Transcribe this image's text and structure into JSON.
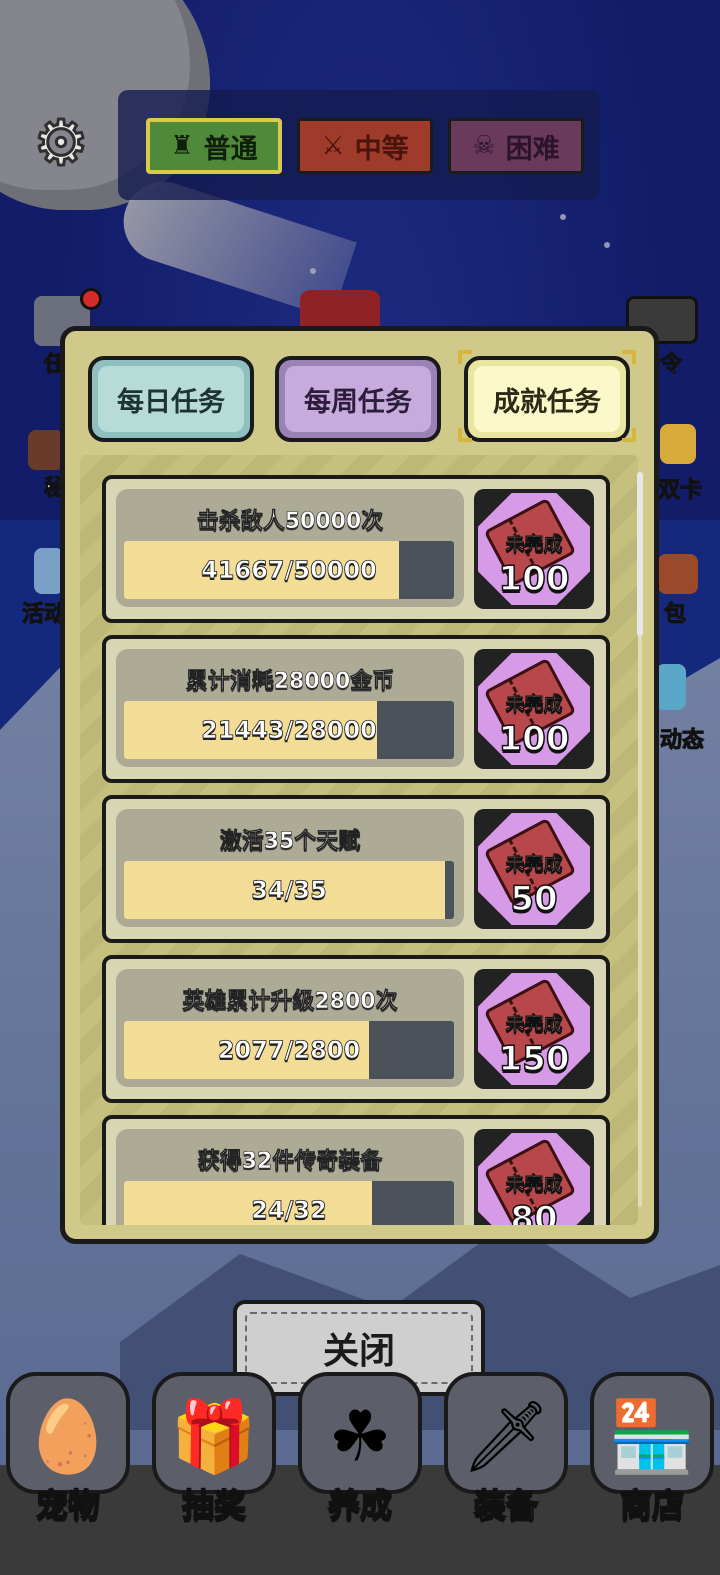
{
  "difficulty": {
    "normal_label": "普通",
    "medium_label": "中等",
    "hard_label": "困难"
  },
  "side_icons": {
    "left": [
      "任",
      "秘",
      "活动"
    ],
    "right": [
      "令",
      "双卡",
      "包",
      "动态"
    ]
  },
  "tabs": {
    "daily": "每日任务",
    "weekly": "每周任务",
    "achievement": "成就任务",
    "selected": "achievement"
  },
  "tasks": [
    {
      "title": "击杀敌人50000次",
      "progress_text": "41667/50000",
      "progress": 0.8333,
      "status": "未完成",
      "reward": "100"
    },
    {
      "title": "累计消耗28000金币",
      "progress_text": "21443/28000",
      "progress": 0.7658,
      "status": "未完成",
      "reward": "100"
    },
    {
      "title": "激活35个天赋",
      "progress_text": "34/35",
      "progress": 0.9714,
      "status": "未完成",
      "reward": "50"
    },
    {
      "title": "英雄累计升级2800次",
      "progress_text": "2077/2800",
      "progress": 0.7418,
      "status": "未完成",
      "reward": "150"
    },
    {
      "title": "获得32件传奇装备",
      "progress_text": "24/32",
      "progress": 0.75,
      "status": "未完成",
      "reward": "80"
    }
  ],
  "close_label": "关闭",
  "bottom_nav": [
    {
      "label": "宠物",
      "icon": "egg-icon"
    },
    {
      "label": "抽奖",
      "icon": "chest-icon"
    },
    {
      "label": "养成",
      "icon": "clover-bottle-icon"
    },
    {
      "label": "装备",
      "icon": "sword-icon"
    },
    {
      "label": "商店",
      "icon": "shop-icon"
    }
  ],
  "colors": {
    "bar_fill": "#f2dc96",
    "bar_empty": "#4b525a",
    "reward_bg": "#d79ae6",
    "modal_bg": "#cfc98a"
  }
}
